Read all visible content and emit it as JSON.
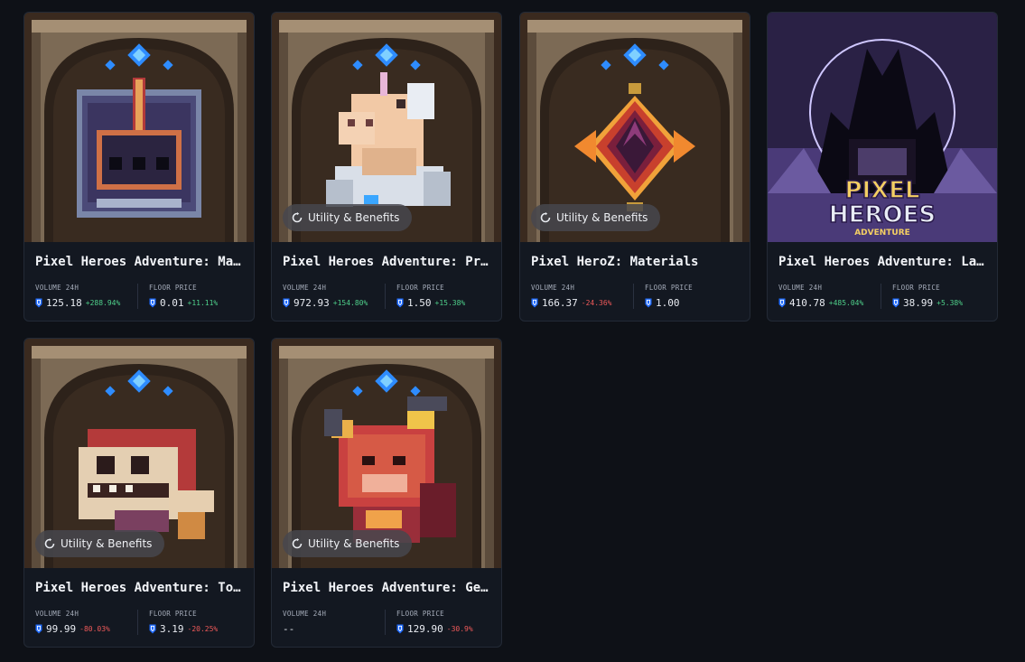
{
  "badge_label": "Utility & Benefits",
  "volume_label": "VOLUME 24H",
  "floor_label": "FLOOR PRICE",
  "currency_icon": "ronin-icon",
  "colors": {
    "up": "#4fd18b",
    "down": "#f05a5a",
    "card_bg": "#131821"
  },
  "cards": [
    {
      "title": "Pixel Heroes Adventure: Mat...",
      "art": "helmet",
      "badge": false,
      "volume": "125.18",
      "volume_change": "+288.94%",
      "volume_dir": "up",
      "floor": "0.01",
      "floor_change": "+11.11%",
      "floor_dir": "up"
    },
    {
      "title": "Pixel Heroes Adventure: Prim...",
      "art": "unicorn",
      "badge": true,
      "volume": "972.93",
      "volume_change": "+154.80%",
      "volume_dir": "up",
      "floor": "1.50",
      "floor_change": "+15.38%",
      "floor_dir": "up"
    },
    {
      "title": "Pixel HeroZ: Materials",
      "art": "gem",
      "badge": true,
      "volume": "166.37",
      "volume_change": "-24.36%",
      "volume_dir": "down",
      "floor": "1.00",
      "floor_change": "",
      "floor_dir": ""
    },
    {
      "title": "Pixel Heroes Adventure: LandZ",
      "art": "landz",
      "badge": false,
      "volume": "410.78",
      "volume_change": "+485.04%",
      "volume_dir": "up",
      "floor": "38.99",
      "floor_change": "+5.38%",
      "floor_dir": "up"
    },
    {
      "title": "Pixel Heroes Adventure: ToyZ",
      "art": "toy",
      "badge": true,
      "volume": "99.99",
      "volume_change": "-80.03%",
      "volume_dir": "down",
      "floor": "3.19",
      "floor_change": "-20.25%",
      "floor_dir": "down"
    },
    {
      "title": "Pixel Heroes Adventure: Gen...",
      "art": "demon",
      "badge": true,
      "volume": "--",
      "volume_change": "",
      "volume_dir": "",
      "floor": "129.90",
      "floor_change": "-30.9%",
      "floor_dir": "down"
    }
  ]
}
